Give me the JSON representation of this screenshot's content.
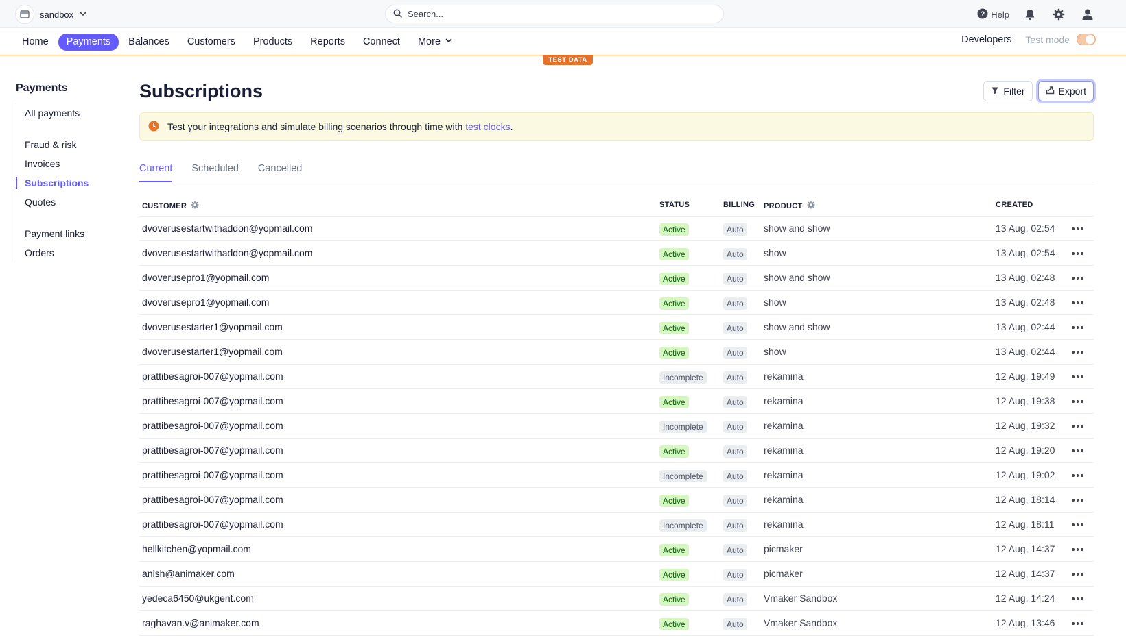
{
  "header": {
    "account_name": "sandbox",
    "search_placeholder": "Search...",
    "help_label": "Help"
  },
  "nav": {
    "items": [
      "Home",
      "Payments",
      "Balances",
      "Customers",
      "Products",
      "Reports",
      "Connect",
      "More"
    ],
    "active": "Payments",
    "developers_label": "Developers",
    "test_mode_label": "Test mode",
    "test_data_label": "TEST DATA"
  },
  "sidebar": {
    "title": "Payments",
    "items": [
      "All payments",
      "Fraud & risk",
      "Invoices",
      "Subscriptions",
      "Quotes",
      "Payment links",
      "Orders"
    ],
    "active": "Subscriptions"
  },
  "main": {
    "title": "Subscriptions",
    "filter_label": "Filter",
    "export_label": "Export",
    "banner_text": "Test your integrations and simulate billing scenarios through time with ",
    "banner_link": "test clocks",
    "banner_suffix": ".",
    "tabs": [
      "Current",
      "Scheduled",
      "Cancelled"
    ],
    "active_tab": "Current"
  },
  "table": {
    "columns": {
      "customer": "CUSTOMER",
      "status": "STATUS",
      "billing": "BILLING",
      "product": "PRODUCT",
      "created": "CREATED"
    },
    "rows": [
      {
        "customer": "dvoverusestartwithaddon@yopmail.com",
        "status": "Active",
        "billing": "Auto",
        "product": "show and show",
        "created": "13 Aug, 02:54"
      },
      {
        "customer": "dvoverusestartwithaddon@yopmail.com",
        "status": "Active",
        "billing": "Auto",
        "product": "show",
        "created": "13 Aug, 02:54"
      },
      {
        "customer": "dvoverusepro1@yopmail.com",
        "status": "Active",
        "billing": "Auto",
        "product": "show and show",
        "created": "13 Aug, 02:48"
      },
      {
        "customer": "dvoverusepro1@yopmail.com",
        "status": "Active",
        "billing": "Auto",
        "product": "show",
        "created": "13 Aug, 02:48"
      },
      {
        "customer": "dvoverusestarter1@yopmail.com",
        "status": "Active",
        "billing": "Auto",
        "product": "show and show",
        "created": "13 Aug, 02:44"
      },
      {
        "customer": "dvoverusestarter1@yopmail.com",
        "status": "Active",
        "billing": "Auto",
        "product": "show",
        "created": "13 Aug, 02:44"
      },
      {
        "customer": "prattibesagroi-007@yopmail.com",
        "status": "Incomplete",
        "billing": "Auto",
        "product": "rekamina",
        "created": "12 Aug, 19:49"
      },
      {
        "customer": "prattibesagroi-007@yopmail.com",
        "status": "Active",
        "billing": "Auto",
        "product": "rekamina",
        "created": "12 Aug, 19:38"
      },
      {
        "customer": "prattibesagroi-007@yopmail.com",
        "status": "Incomplete",
        "billing": "Auto",
        "product": "rekamina",
        "created": "12 Aug, 19:32"
      },
      {
        "customer": "prattibesagroi-007@yopmail.com",
        "status": "Active",
        "billing": "Auto",
        "product": "rekamina",
        "created": "12 Aug, 19:20"
      },
      {
        "customer": "prattibesagroi-007@yopmail.com",
        "status": "Incomplete",
        "billing": "Auto",
        "product": "rekamina",
        "created": "12 Aug, 19:02"
      },
      {
        "customer": "prattibesagroi-007@yopmail.com",
        "status": "Active",
        "billing": "Auto",
        "product": "rekamina",
        "created": "12 Aug, 18:14"
      },
      {
        "customer": "prattibesagroi-007@yopmail.com",
        "status": "Incomplete",
        "billing": "Auto",
        "product": "rekamina",
        "created": "12 Aug, 18:11"
      },
      {
        "customer": "hellkitchen@yopmail.com",
        "status": "Active",
        "billing": "Auto",
        "product": "picmaker",
        "created": "12 Aug, 14:37"
      },
      {
        "customer": "anish@animaker.com",
        "status": "Active",
        "billing": "Auto",
        "product": "picmaker",
        "created": "12 Aug, 14:37"
      },
      {
        "customer": "yedeca6450@ukgent.com",
        "status": "Active",
        "billing": "Auto",
        "product": "Vmaker Sandbox",
        "created": "12 Aug, 14:24"
      },
      {
        "customer": "raghavan.v@animaker.com",
        "status": "Active",
        "billing": "Auto",
        "product": "Vmaker Sandbox",
        "created": "12 Aug, 13:46"
      }
    ]
  },
  "colors": {
    "accent": "#635bff",
    "test_mode": "#e5722a",
    "active_badge_bg": "#d7f7c2",
    "active_badge_text": "#05690d"
  }
}
